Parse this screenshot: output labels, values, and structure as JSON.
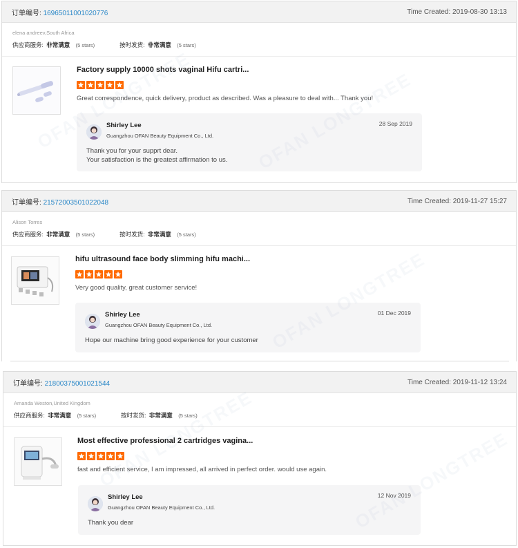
{
  "common": {
    "order_label": "订单编号:",
    "time_label": "Time Created:",
    "supplier_service_label": "供应商服务:",
    "on_time_label": "按时发货:",
    "rating_value": "非常满意",
    "rating_stars_text": "(5 stars)",
    "rating_stars": 5,
    "star_color": "#ff6a00",
    "link_color": "#2b88c8",
    "watermark_text": "OFAN LONGTREE"
  },
  "reviews": [
    {
      "order_number": "16965011001020776",
      "time_created": "2019-08-30 13:13",
      "buyer": "elena andreev,South Africa",
      "product_title": "Factory supply 10000 shots vaginal Hifu cartri...",
      "product_image_icon": "hifu-cartridge-icon",
      "feedback": "Great correspondence, quick delivery, product as described. Was a pleasure to deal with... Thank you!",
      "reply": {
        "name": "Shirley Lee",
        "company": "Guangzhou OFAN Beauty Equipment Co., Ltd.",
        "date": "28 Sep 2019",
        "message": [
          "Thank you for your supprt dear.",
          "Your satisfaction is the greatest affirmation to us."
        ]
      }
    },
    {
      "order_number": "21572003501022048",
      "time_created": "2019-11-27 15:27",
      "buyer": "Alison Torres",
      "product_title": "hifu ultrasound face body slimming hifu machi...",
      "product_image_icon": "hifu-machine-icon",
      "feedback": "Very good quality, great customer service!",
      "reply": {
        "name": "Shirley Lee",
        "company": "Guangzhou OFAN Beauty Equipment Co., Ltd.",
        "date": "01 Dec 2019",
        "message": [
          "Hope our machine bring good experience for your customer"
        ]
      }
    },
    {
      "order_number": "21800375001021544",
      "time_created": "2019-11-12 13:24",
      "buyer": "Amanda Weston,United Kingdom",
      "product_title": "Most effective professional 2 cartridges vagina...",
      "product_image_icon": "vaginal-hifu-device-icon",
      "feedback": "fast and efficient service, I am impressed, all arrived in perfect order. would use again.",
      "reply": {
        "name": "Shirley Lee",
        "company": "Guangzhou OFAN Beauty Equipment Co., Ltd.",
        "date": "12 Nov 2019",
        "message": [
          "Thank you dear"
        ]
      }
    }
  ]
}
